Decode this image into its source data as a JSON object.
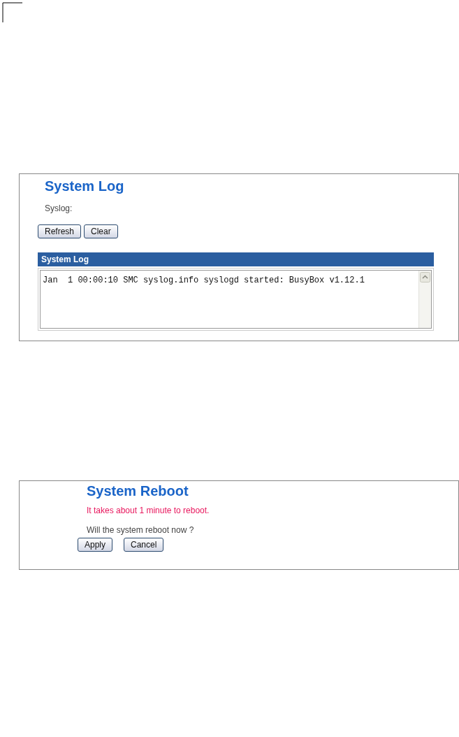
{
  "system_log": {
    "title": "System Log",
    "label": "Syslog:",
    "buttons": [
      "Refresh",
      "Clear"
    ],
    "log_header": "System Log",
    "log_lines": [
      "Jan  1 00:00:10 SMC syslog.info syslogd started: BusyBox v1.12.1"
    ]
  },
  "system_reboot": {
    "title": "System Reboot",
    "notice": "It takes about 1 minute to reboot.",
    "question": "Will the system reboot now ?",
    "buttons": [
      "Apply",
      "Cancel"
    ]
  }
}
